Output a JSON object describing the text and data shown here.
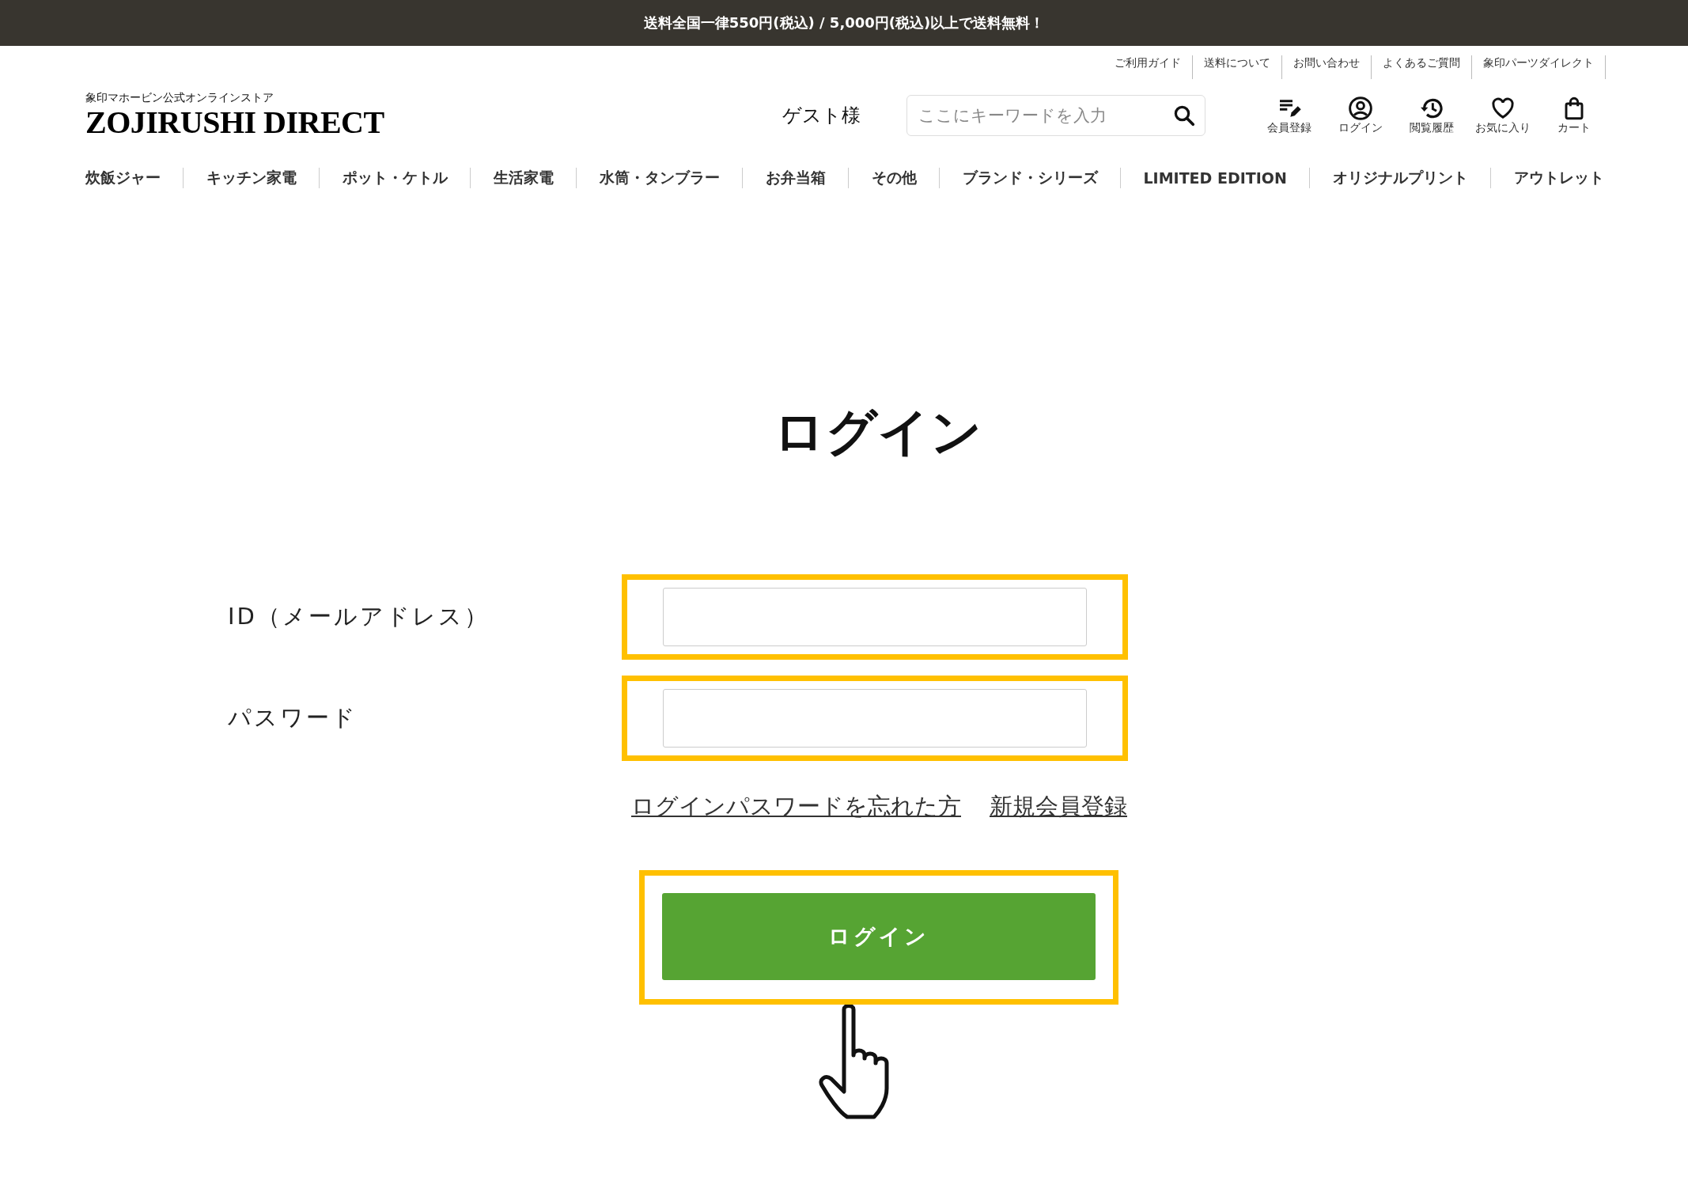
{
  "announcement": "送料全国一律550円(税込) / 5,000円(税込)以上で送料無料！",
  "utility_links": [
    "ご利用ガイド",
    "送料について",
    "お問い合わせ",
    "よくあるご質問",
    "象印パーツダイレクト"
  ],
  "logo": {
    "tagline": "象印マホービン公式オンラインストア",
    "name": "ZOJIRUSHI DIRECT"
  },
  "greeting": "ゲスト様",
  "search": {
    "placeholder": "ここにキーワードを入力"
  },
  "header_icons": [
    {
      "kind": "register",
      "label": "会員登録"
    },
    {
      "kind": "user",
      "label": "ログイン"
    },
    {
      "kind": "history",
      "label": "閲覧履歴"
    },
    {
      "kind": "heart",
      "label": "お気に入り"
    },
    {
      "kind": "bag",
      "label": "カート"
    }
  ],
  "nav": [
    "炊飯ジャー",
    "キッチン家電",
    "ポット・ケトル",
    "生活家電",
    "水筒・タンブラー",
    "お弁当箱",
    "その他",
    "ブランド・シリーズ",
    "LIMITED EDITION",
    "オリジナルプリント",
    "アウトレット"
  ],
  "title": "ログイン",
  "form": {
    "fields": [
      "ID（メールアドレス）",
      "パスワード"
    ],
    "links": [
      "ログインパスワードを忘れた方",
      "新規会員登録"
    ],
    "submit": "ログイン"
  }
}
